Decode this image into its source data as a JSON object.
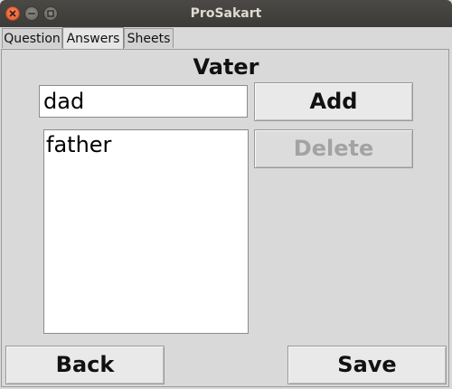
{
  "window": {
    "title": "ProSakart"
  },
  "tabs": [
    {
      "label": "Question",
      "active": false
    },
    {
      "label": "Answers",
      "active": true
    },
    {
      "label": "Sheets",
      "active": false
    }
  ],
  "answers": {
    "word": "Vater",
    "entry_value": "dad",
    "list_items": [
      "father"
    ],
    "add_label": "Add",
    "delete_label": "Delete",
    "delete_enabled": false
  },
  "footer": {
    "back_label": "Back",
    "save_label": "Save"
  },
  "colors": {
    "titlebar": "#3c3b37",
    "close_button": "#e35b2a",
    "window_bg": "#d9d9d9"
  }
}
